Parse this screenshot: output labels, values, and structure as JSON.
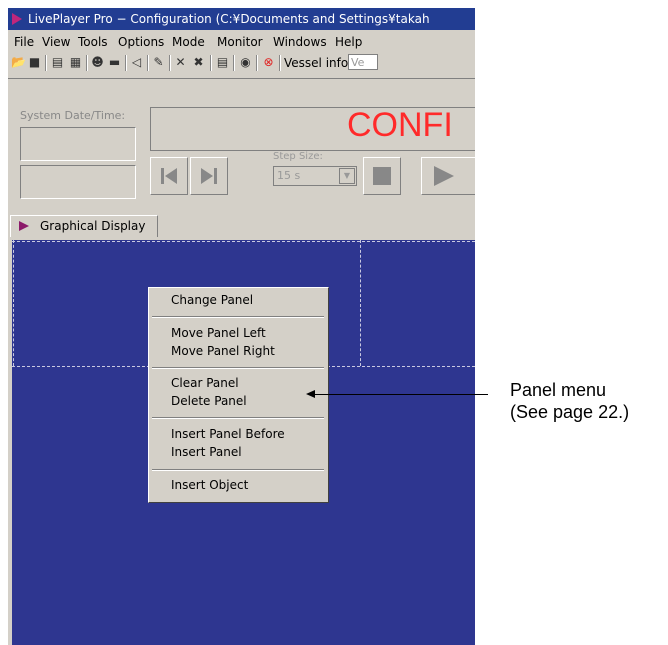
{
  "window": {
    "title": "LivePlayer Pro − Configuration (C:¥Documents and Settings¥takah"
  },
  "menubar": [
    "File",
    "View",
    "Tools",
    "Options",
    "Mode",
    "Monitor",
    "Windows",
    "Help"
  ],
  "toolbar": {
    "vessel_label": "Vessel info",
    "vessel_value": "Ve"
  },
  "panel": {
    "system_datetime_label": "System Date/Time:",
    "status_text": "CONFI",
    "step_size_label": "Step Size:",
    "step_size_value": "15 s",
    "accent_color": "#ff2a2a"
  },
  "tab": {
    "label": "Graphical Display"
  },
  "display": {
    "background": "#2e3690"
  },
  "context_menu": {
    "items": [
      "Change Panel",
      "Move Panel Left",
      "Move Panel Right",
      "Clear Panel",
      "Delete Panel",
      "Insert Panel Before",
      "Insert Panel",
      "Insert Object"
    ]
  },
  "callout": {
    "line1": "Panel menu",
    "line2": "(See page 22.)"
  }
}
